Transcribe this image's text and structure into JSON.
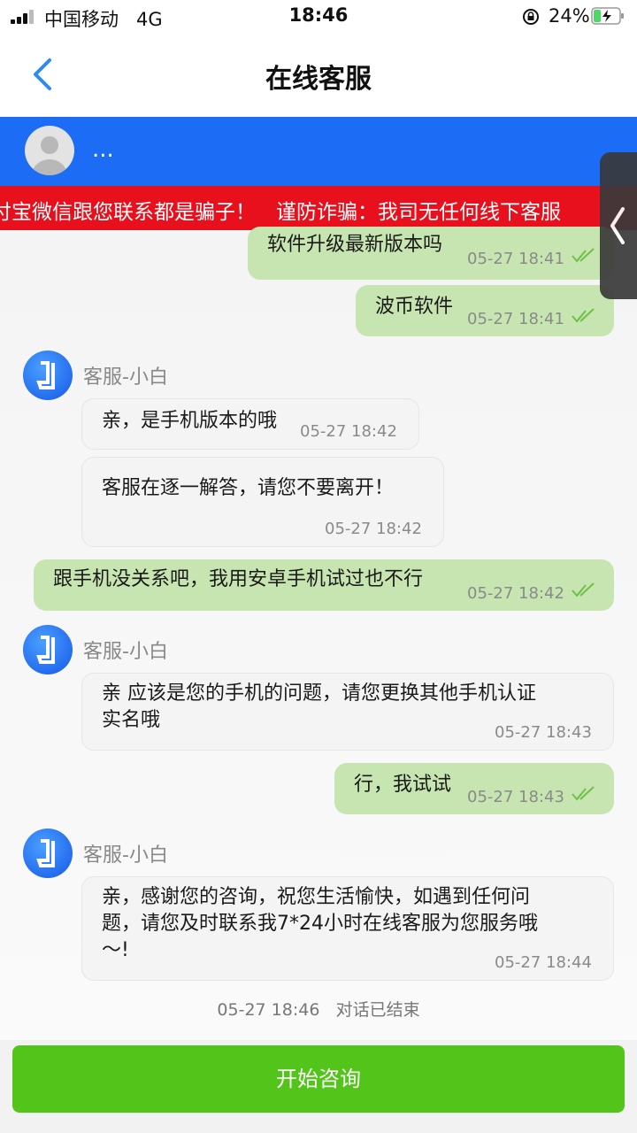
{
  "status_bar": {
    "carrier": "中国移动",
    "network": "4G",
    "time": "18:46",
    "battery_percent": "24%"
  },
  "nav": {
    "title": "在线客服"
  },
  "agent_header": {
    "name": "..."
  },
  "marquee": {
    "text": "付宝微信跟您联系都是骗子！　谨防诈骗：我司无任何线下客服"
  },
  "messages": [
    {
      "dir": "out",
      "text": "软件升级最新版本吗",
      "time": "05-27 18:41",
      "read": true
    },
    {
      "dir": "out",
      "text": "波币软件",
      "time": "05-27 18:41",
      "read": true
    },
    {
      "dir": "in",
      "agent": "客服-小白"
    },
    {
      "dir": "in",
      "text": "亲，是手机版本的哦",
      "time": "05-27 18:42"
    },
    {
      "dir": "in",
      "text": "客服在逐一解答，请您不要离开！",
      "time": "05-27 18:42"
    },
    {
      "dir": "out",
      "text": "跟手机没关系吧，我用安卓手机试过也不行",
      "time": "05-27 18:42",
      "read": true
    },
    {
      "dir": "in",
      "agent": "客服-小白"
    },
    {
      "dir": "in",
      "text_line1": "亲  应该是您的手机的问题，请您更换其他手机认证",
      "text_line2": "实名哦",
      "time": "05-27 18:43"
    },
    {
      "dir": "out",
      "text": "行，我试试",
      "time": "05-27 18:43",
      "read": true
    },
    {
      "dir": "in",
      "agent": "客服-小白"
    },
    {
      "dir": "in",
      "text_line1": "亲，感谢您的咨询，祝您生活愉快，如遇到任何问",
      "text_line2": "题，请您及时联系我7*24小时在线客服为您服务哦",
      "text_line3": "～!",
      "time": "05-27 18:44"
    }
  ],
  "end_note": {
    "time": "05-27 18:46",
    "text": "对话已结束"
  },
  "bottom": {
    "start_button": "开始咨询"
  },
  "colors": {
    "header_blue": "#1c6cf5",
    "marquee_red": "#e8101c",
    "button_green": "#52c41a",
    "outgoing_bubble": "#c7e5b0"
  }
}
